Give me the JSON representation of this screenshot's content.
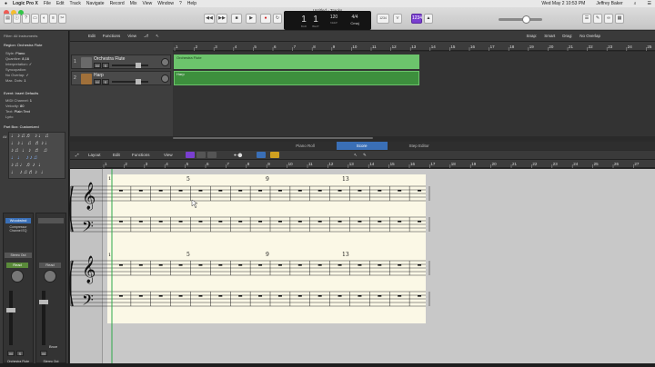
{
  "menubar": {
    "apple": "",
    "app": "Logic Pro X",
    "items": [
      "File",
      "Edit",
      "Track",
      "Navigate",
      "Record",
      "Mix",
      "View",
      "Window",
      "?",
      "Help"
    ],
    "clock": "Wed May 2  10:53 PM",
    "user": "Jeffrey Baker"
  },
  "window": {
    "title": "Untitled - Tracks"
  },
  "transport": {
    "position_bar": "1",
    "position_beat": "1",
    "bar_label": "BAR",
    "beat_label": "BEAT",
    "tempo": "120",
    "tempo_label": "KEEP",
    "sig_top": "4/4",
    "key": "Cmaj",
    "counter": "1234"
  },
  "inspector": {
    "filter": "Filter: All Instruments",
    "region": "Region: Orchestra Flute",
    "rows": [
      {
        "k": "Style:",
        "v": "Piano"
      },
      {
        "k": "Quantize:",
        "v": "8,16"
      },
      {
        "k": "Interpretation:",
        "v": "✓"
      },
      {
        "k": "Syncopation:",
        "v": ""
      },
      {
        "k": "No Overlap:",
        "v": "✓"
      },
      {
        "k": "Max. Dots:",
        "v": "1"
      }
    ],
    "event": "Event: Insert Defaults",
    "event_rows": [
      {
        "k": "MIDI Channel:",
        "v": "1"
      },
      {
        "k": "Velocity:",
        "v": "80"
      },
      {
        "k": "Text:",
        "v": "Plain Text"
      },
      {
        "k": "Lyric:",
        "v": ""
      }
    ],
    "partbox": "Part Box: Customized",
    "tab_all": "All",
    "strip1": {
      "plugin": "Woodwind",
      "eq": "Compressor Channel EQ",
      "send": "Stereo Out",
      "mode": "Read",
      "m": "M",
      "s": "S",
      "name": "Orchestra Flute"
    },
    "strip2": {
      "mode": "Read",
      "m": "M",
      "s": "S",
      "name": "Stereo Out",
      "bnce": "Bnce"
    }
  },
  "tracks_toolbar": {
    "edit": "Edit",
    "functions": "Functions",
    "view": "View",
    "snap_label": "Snap:",
    "snap_value": "Smart",
    "drag_label": "Drag:",
    "drag_value": "No Overlap"
  },
  "tracks": [
    {
      "num": "1",
      "name": "Orchestra Flute",
      "region": "Orchestra Flute"
    },
    {
      "num": "2",
      "name": "Harp",
      "region": "Harp"
    }
  ],
  "ruler_top": [
    "1",
    "2",
    "3",
    "4",
    "5",
    "6",
    "7",
    "8",
    "9",
    "10",
    "11",
    "12",
    "13",
    "14",
    "15",
    "16",
    "17",
    "18",
    "19",
    "20",
    "21",
    "22",
    "23",
    "24",
    "25"
  ],
  "editor_tabs": [
    {
      "label": "Piano Roll",
      "active": false
    },
    {
      "label": "Score",
      "active": true
    },
    {
      "label": "Step Editor",
      "active": false
    }
  ],
  "editor_toolbar": {
    "layout": "Layout",
    "edit": "Edit",
    "functions": "Functions",
    "view": "View"
  },
  "editor_ruler": [
    "1",
    "2",
    "3",
    "4",
    "5",
    "6",
    "7",
    "8",
    "9",
    "10",
    "11",
    "12",
    "13",
    "14",
    "15",
    "16",
    "17",
    "18",
    "19",
    "20",
    "21",
    "22",
    "23",
    "24",
    "25",
    "26",
    "27"
  ],
  "score": {
    "measure_numbers_system1": [
      "5",
      "9",
      "13"
    ],
    "measure_numbers_system2": [
      "5",
      "9",
      "13"
    ],
    "system_start": "1"
  },
  "colors": {
    "accent": "#3a6fb6",
    "region_green": "#3d8f3d",
    "region_selected": "#6cc46c",
    "paper": "#fbf8e6"
  }
}
